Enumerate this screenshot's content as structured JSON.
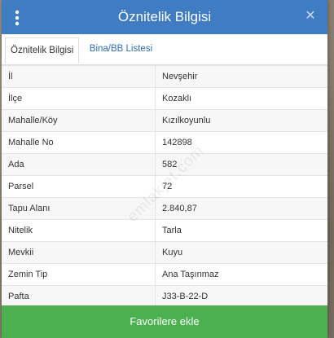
{
  "dialog": {
    "title": "Öznitelik Bilgisi",
    "close_glyph": "✕"
  },
  "tabs": [
    {
      "label": "Öznitelik Bilgisi",
      "active": true
    },
    {
      "label": "Bina/BB Listesi",
      "active": false
    }
  ],
  "attributes": [
    {
      "label": "İl",
      "value": "Nevşehir"
    },
    {
      "label": "İlçe",
      "value": "Kozaklı"
    },
    {
      "label": "Mahalle/Köy",
      "value": "Kızılkoyunlu"
    },
    {
      "label": "Mahalle No",
      "value": "142898"
    },
    {
      "label": "Ada",
      "value": "582"
    },
    {
      "label": "Parsel",
      "value": "72"
    },
    {
      "label": "Tapu Alanı",
      "value": "2.840,87"
    },
    {
      "label": "Nitelik",
      "value": "Tarla"
    },
    {
      "label": "Mevkii",
      "value": "Kuyu"
    },
    {
      "label": "Zemin Tip",
      "value": "Ana Taşınmaz"
    },
    {
      "label": "Pafta",
      "value": "J33-B-22-D"
    }
  ],
  "footer": {
    "favorite_label": "Favorilere ekle"
  },
  "watermark": "emlakjet.com",
  "colors": {
    "header": "#3f7cc1",
    "tab_link": "#2f6fb3",
    "favorite_button": "#4caf50"
  },
  "icons": {
    "menu": "vertical-ellipsis-icon",
    "close": "close-icon"
  }
}
